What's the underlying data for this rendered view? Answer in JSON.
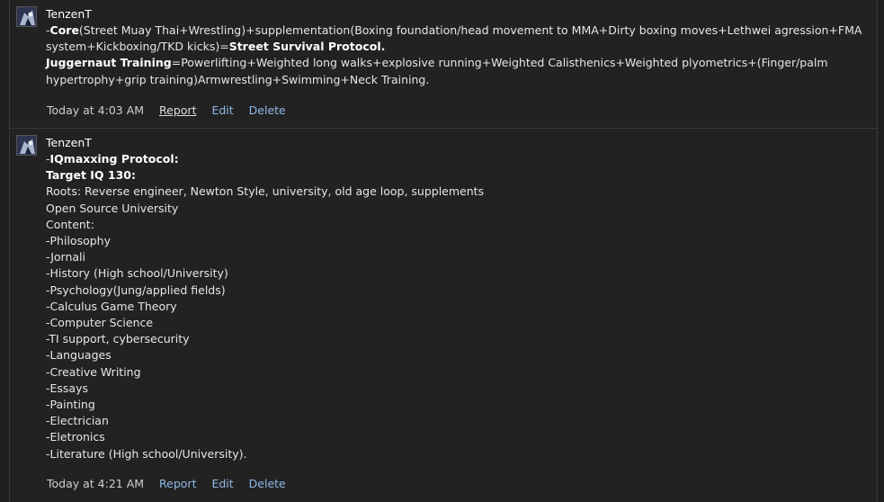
{
  "posts": [
    {
      "username": "TenzenT",
      "core_prefix": "-",
      "core_label": "Core",
      "core_text": "(Street Muay Thai+Wrestling)+supplementation(Boxing foundation/head movement to MMA+Dirty boxing moves+Lethwei agression+FMA system+Kickboxing/TKD kicks)=",
      "core_result": "Street Survival Protocol.",
      "jugg_label": "Juggernaut Training",
      "jugg_text": "=Powerlifting+Weighted long walks+explosive running+Weighted Calisthenics+Weighted plyometrics+(Finger/palm hypertrophy+grip training)Armwrestling+Swimming+Neck Training.",
      "timestamp": "Today at 4:03 AM",
      "report": "Report",
      "edit": "Edit",
      "delete": "Delete"
    },
    {
      "username": "TenzenT",
      "heading_prefix": "-",
      "heading": "IQmaxxing Protocol:",
      "target": "Target IQ 130:",
      "lines": [
        "Roots: Reverse engineer, Newton Style, university, old age loop, supplements",
        "Open Source University",
        "Content:",
        "-Philosophy",
        "-Jornali",
        "-History (High school/University)",
        "-Psychology(Jung/applied fields)",
        "-Calculus Game Theory",
        "-Computer Science",
        "-TI support, cybersecurity",
        "-Languages",
        "-Creative Writing",
        "-Essays",
        "-Painting",
        "-Electrician",
        "-Eletronics",
        "-Literature (High school/University)."
      ],
      "timestamp": "Today at 4:21 AM",
      "report": "Report",
      "edit": "Edit",
      "delete": "Delete"
    }
  ],
  "colors": {
    "background": "#1f1f1f",
    "panel": "#222222",
    "link": "#8fb8e8",
    "text": "#e6e6e6"
  }
}
